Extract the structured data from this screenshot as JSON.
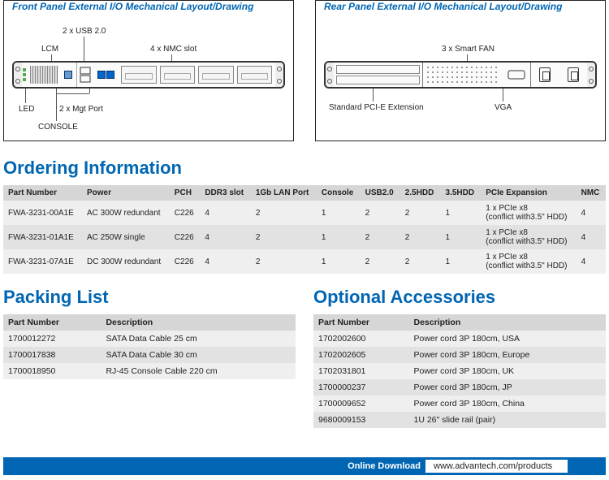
{
  "panels": {
    "front_title": "Front Panel External I/O Mechanical Layout/Drawing",
    "rear_title": "Rear Panel External I/O Mechanical Layout/Drawing",
    "front_top": {
      "usb": "2 x USB 2.0",
      "lcm": "LCM",
      "nmc": "4 x NMC slot"
    },
    "front_bottom": {
      "led": "LED",
      "mgt": "2 x Mgt Port",
      "console": "CONSOLE"
    },
    "rear_top": {
      "fan": "3 x Smart FAN"
    },
    "rear_bottom": {
      "pcie": "Standard PCI-E Extension",
      "vga": "VGA"
    }
  },
  "ordering": {
    "heading": "Ordering Information",
    "headers": [
      "Part Number",
      "Power",
      "PCH",
      "DDR3 slot",
      "1Gb LAN Port",
      "Console",
      "USB2.0",
      "2.5HDD",
      "3.5HDD",
      "PCIe Expansion",
      "NMC"
    ],
    "rows": [
      [
        "FWA-3231-00A1E",
        "AC 300W redundant",
        "C226",
        "4",
        "2",
        "1",
        "2",
        "2",
        "1",
        "1 x PCIe x8\n(conflict with3.5\" HDD)",
        "4"
      ],
      [
        "FWA-3231-01A1E",
        "AC 250W single",
        "C226",
        "4",
        "2",
        "1",
        "2",
        "2",
        "1",
        "1 x PCIe x8\n(conflict with3.5\" HDD)",
        "4"
      ],
      [
        "FWA-3231-07A1E",
        "DC 300W redundant",
        "C226",
        "4",
        "2",
        "1",
        "2",
        "2",
        "1",
        "1 x PCIe x8\n(conflict with3.5\" HDD)",
        "4"
      ]
    ]
  },
  "packing": {
    "heading": "Packing List",
    "headers": [
      "Part Number",
      "Description"
    ],
    "rows": [
      [
        "1700012272",
        "SATA Data Cable 25 cm"
      ],
      [
        "1700017838",
        "SATA Data Cable 30 cm"
      ],
      [
        "1700018950",
        "RJ-45 Console Cable 220 cm"
      ]
    ]
  },
  "accessories": {
    "heading": "Optional Accessories",
    "headers": [
      "Part Number",
      "Description"
    ],
    "rows": [
      [
        "1702002600",
        "Power cord 3P 180cm, USA"
      ],
      [
        "1702002605",
        "Power cord 3P 180cm, Europe"
      ],
      [
        "1702031801",
        "Power cord 3P 180cm, UK"
      ],
      [
        "1700000237",
        "Power cord 3P 180cm, JP"
      ],
      [
        "1700009652",
        "Power cord 3P 180cm, China"
      ],
      [
        "9680009153",
        "1U 26\" slide rail (pair)"
      ]
    ]
  },
  "footer": {
    "label": "Online Download",
    "url": "www.advantech.com/products"
  }
}
